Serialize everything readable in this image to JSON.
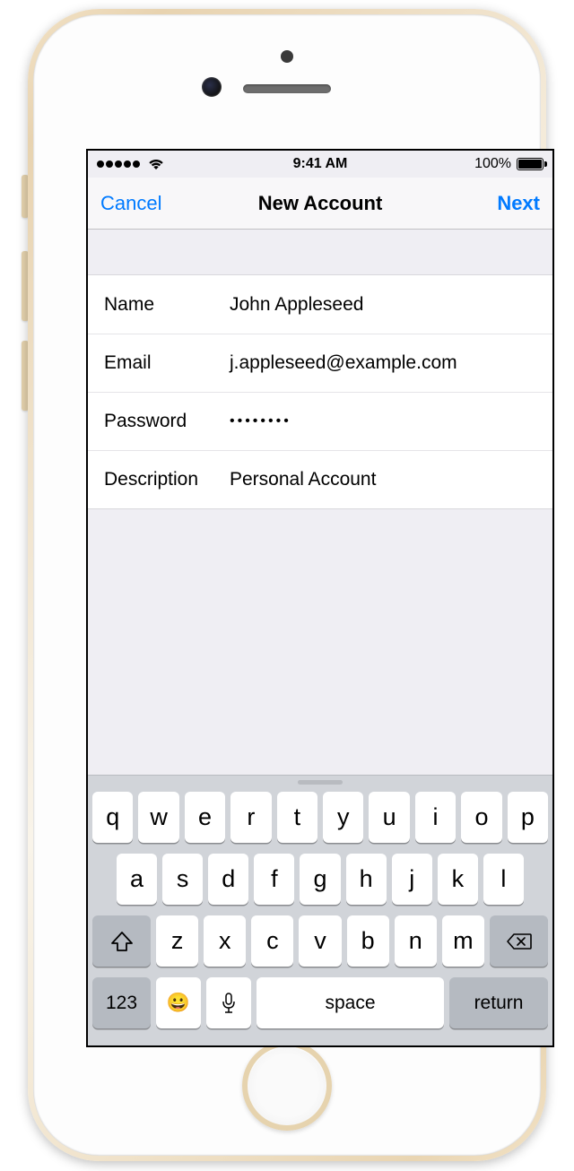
{
  "statusbar": {
    "time": "9:41 AM",
    "battery_pct": "100%"
  },
  "navbar": {
    "left": "Cancel",
    "title": "New Account",
    "right": "Next"
  },
  "form": {
    "name_label": "Name",
    "name_value": "John Appleseed",
    "email_label": "Email",
    "email_value": "j.appleseed@example.com",
    "password_label": "Password",
    "password_value": "••••••••",
    "desc_label": "Description",
    "desc_value": "Personal Account"
  },
  "keyboard": {
    "row1": [
      "q",
      "w",
      "e",
      "r",
      "t",
      "y",
      "u",
      "i",
      "o",
      "p"
    ],
    "row2": [
      "a",
      "s",
      "d",
      "f",
      "g",
      "h",
      "j",
      "k",
      "l"
    ],
    "row3": [
      "z",
      "x",
      "c",
      "v",
      "b",
      "n",
      "m"
    ],
    "num_key": "123",
    "space_label": "space",
    "return_label": "return"
  }
}
